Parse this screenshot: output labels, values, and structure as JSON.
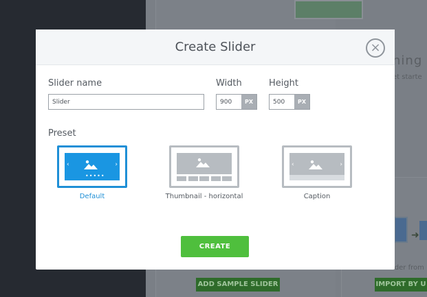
{
  "background": {
    "heading_fragment": "ning p",
    "sub_fragment": "et starte",
    "sample_button": "ADD SAMPLE SLIDER",
    "import_button": "IMPORT BY U",
    "footer_fragment": "ider from"
  },
  "modal": {
    "title": "Create Slider",
    "close_icon": "×",
    "slider_name_label": "Slider name",
    "slider_name_value": "Slider",
    "width_label": "Width",
    "width_value": "900",
    "width_unit": "PX",
    "height_label": "Height",
    "height_value": "500",
    "height_unit": "PX",
    "preset_label": "Preset",
    "presets": [
      {
        "label": "Default",
        "selected": true,
        "icon": "image-icon"
      },
      {
        "label": "Thumbnail - horizontal",
        "selected": false,
        "icon": "image-icon"
      },
      {
        "label": "Caption",
        "selected": false,
        "icon": "image-icon"
      }
    ],
    "create_label": "CREATE"
  },
  "colors": {
    "accent_blue": "#1a96e2",
    "create_green": "#4fbf3d",
    "preset_gray": "#b7bcc1"
  }
}
